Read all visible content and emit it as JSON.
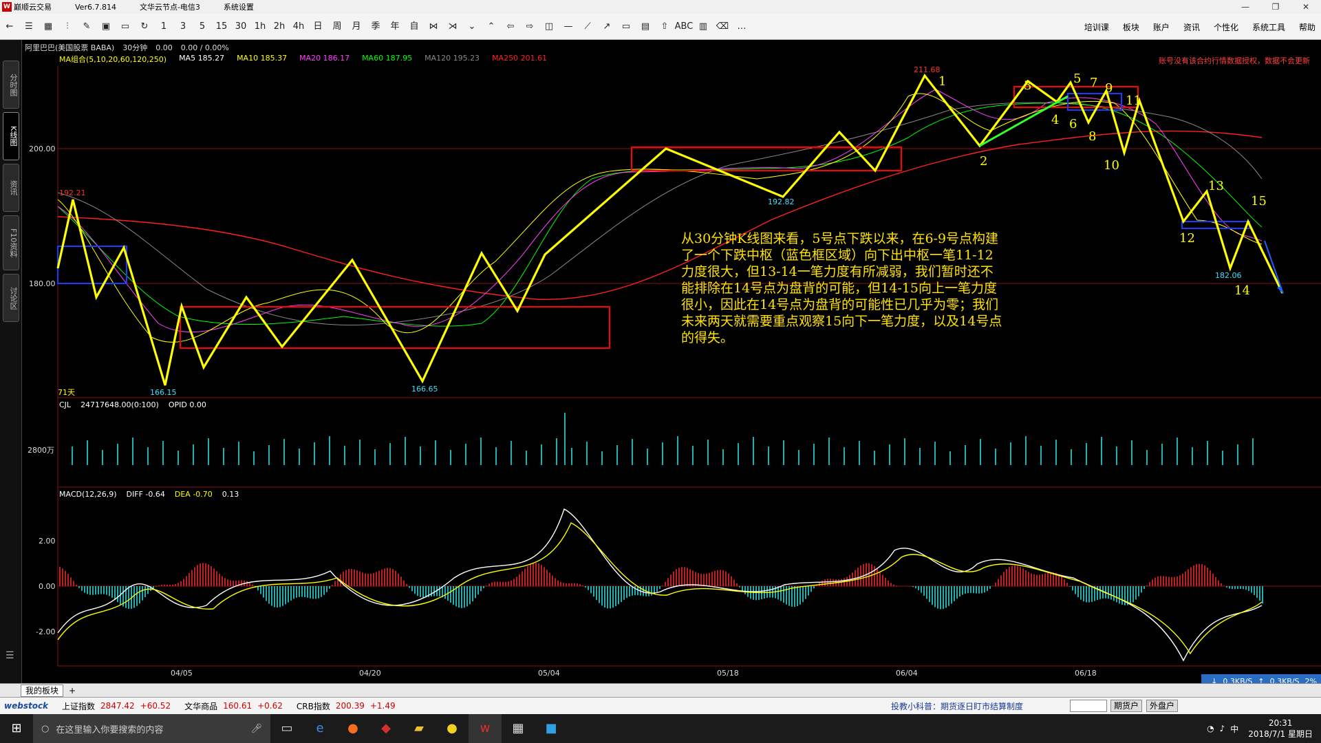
{
  "window": {
    "app_name": "巅顺云交易",
    "version": "Ver6.7.814",
    "server": "文华云节点-电信3",
    "menu": "系统设置"
  },
  "toolbar": {
    "periods": [
      "1",
      "3",
      "5",
      "15",
      "30",
      "1h",
      "2h",
      "4h",
      "日",
      "周",
      "月",
      "季",
      "年"
    ],
    "right_menu": [
      "培训课",
      "板块",
      "账户",
      "资讯",
      "个性化",
      "系统工具",
      "帮助"
    ]
  },
  "left_tabs": [
    "分时图",
    "K线图",
    "资讯",
    "F10资料",
    "讨论区"
  ],
  "info": {
    "name": "阿里巴巴(美国股票 BABA)",
    "period": "30分钟",
    "change": "0.00",
    "change_pct": "0.00 / 0.00%"
  },
  "ma": {
    "group": "MA组合(5,10,20,60,120,250)",
    "ma5": "MA5 185.27",
    "ma10": "MA10 185.37",
    "ma20": "MA20 186.17",
    "ma60": "MA60 187.95",
    "ma120": "MA120 195.23",
    "ma250": "MA250 201.61"
  },
  "warning": "账号没有该合约行情数据授权，数据不会更新",
  "main_chart": {
    "y_labels": [
      "200.00",
      "180.00"
    ],
    "price_labels": [
      "211.68",
      "192.21",
      "166.15",
      "166.65",
      "192.82",
      "182.06"
    ],
    "footer": "71天",
    "stroke_labels": [
      "1",
      "2",
      "3",
      "4",
      "5",
      "6",
      "7",
      "8",
      "9",
      "10",
      "11",
      "12",
      "13",
      "14",
      "15"
    ]
  },
  "volume": {
    "header": "CJL",
    "value": "24717648.00(0:100)",
    "opid": "OPID 0.00",
    "y_label": "2800万"
  },
  "macd": {
    "header": "MACD(12,26,9)",
    "diff": "DIFF -0.64",
    "dea": "DEA -0.70",
    "value": "0.13",
    "y_labels": [
      "2.00",
      "0.00",
      "-2.00"
    ]
  },
  "annotation": "从30分钟K线图来看，5号点下跌以来，在6-9号点构建了一个下跌中枢（蓝色框区域）向下出中枢一笔11-12力度很大，但13-14一笔力度有所减弱，我们暂时还不能排除在14号点为盘背的可能，但14-15向上一笔力度很小，因此在14号点为盘背的可能性已几乎为零；我们未来两天就需要重点观察15向下一笔力度，以及14号点的得失。",
  "x_labels": [
    "04/05",
    "04/20",
    "05/04",
    "05/18",
    "06/04",
    "06/18"
  ],
  "speed": {
    "down": "0.3KB/S",
    "up": "0.3KB/S",
    "pct": "2%"
  },
  "bottom_tab": "我的板块",
  "status": {
    "brand": "webstock",
    "indices": [
      {
        "name": "上证指数",
        "value": "2847.42",
        "chg": "+60.52"
      },
      {
        "name": "文华商品",
        "value": "160.61",
        "chg": "+0.62"
      },
      {
        "name": "CRB指数",
        "value": "200.39",
        "chg": "+1.49"
      }
    ],
    "tip": "投教小科普：期货逐日盯市结算制度",
    "btn1": "期货户",
    "btn2": "外盘户"
  },
  "taskbar": {
    "search_placeholder": "在这里输入你要搜索的内容",
    "time": "20:31",
    "date": "2018/7/1 星期日",
    "ime": "中"
  },
  "colors": {
    "ma5": "#ffffff",
    "ma10": "#ffff00",
    "ma20": "#ff40ff",
    "ma60": "#00ff00",
    "ma120": "#888888",
    "ma250": "#ff2020",
    "bi": "#ffff00",
    "zhongshu_red": "#ff0000",
    "zhongshu_blue": "#1a3cff",
    "macd_up": "#c02020",
    "macd_down": "#20b0b0"
  }
}
